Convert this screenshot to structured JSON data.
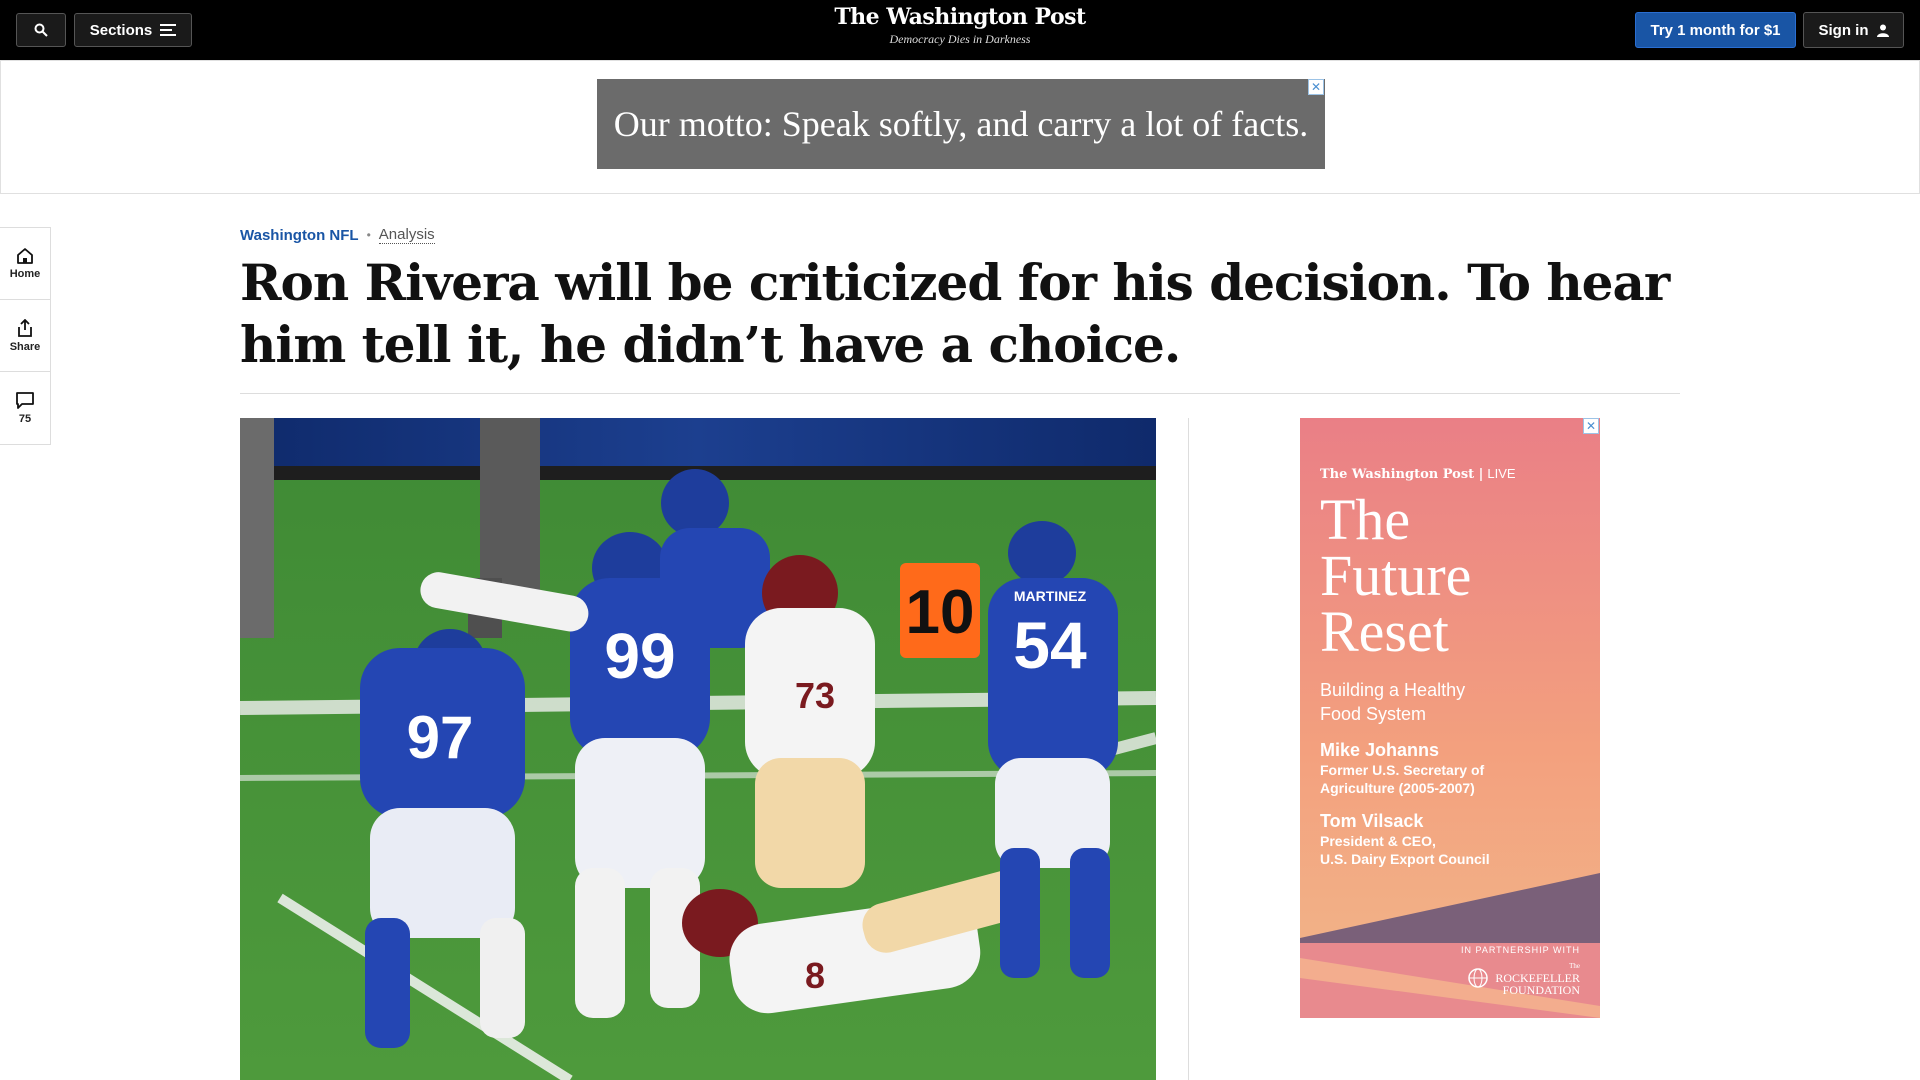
{
  "topbar": {
    "sections_label": "Sections",
    "logo": "The Washington Post",
    "tagline": "Democracy Dies in Darkness",
    "try_label": "Try 1 month for $1",
    "signin_label": "Sign in",
    "accent": "#1955a5"
  },
  "ad_top": {
    "text": "Our motto: Speak softly, and carry a lot of facts.",
    "close": "✕"
  },
  "rail": {
    "home": "Home",
    "share": "Share",
    "comments_count": "75"
  },
  "article": {
    "section": "Washington NFL",
    "separator": "•",
    "label": "Analysis",
    "headline": "Ron Rivera will be criticized for his decision. To hear him tell it, he didn’t have a choice."
  },
  "photo": {
    "marker_number": "10",
    "jerseys": [
      "97",
      "99",
      "73",
      "8",
      "54"
    ],
    "player_name": "MARTINEZ"
  },
  "ad_side": {
    "close": "✕",
    "brand": "The Washington Post",
    "brand_suffix": "LIVE",
    "title_lines": [
      "The",
      "Future",
      "Reset"
    ],
    "subtitle_lines": [
      "Building a Healthy",
      "Food System"
    ],
    "speaker1_name": "Mike Johanns",
    "speaker1_role_lines": [
      "Former U.S. Secretary of",
      "Agriculture (2005-2007)"
    ],
    "speaker2_name": "Tom Vilsack",
    "speaker2_role_lines": [
      "President & CEO,",
      "U.S. Dairy Export Council"
    ],
    "partner_label": "IN PARTNERSHIP WITH",
    "foundation_small": "The",
    "foundation_lines": [
      "ROCKEFELLER",
      "FOUNDATION"
    ]
  }
}
